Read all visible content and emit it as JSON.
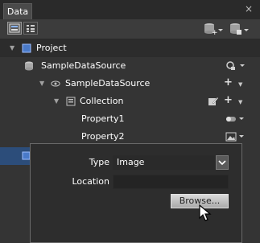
{
  "panel": {
    "title": "Data",
    "close_glyph": "×"
  },
  "toolbar": {
    "view_list_icon": "list-view-icon",
    "view_details_icon": "details-view-icon",
    "add_sample_data_icon": "add-sample-data-icon",
    "add_live_data_icon": "add-live-data-icon"
  },
  "tree": {
    "project_label": "Project",
    "datasource_label": "SampleDataSource",
    "datasource_child_label": "SampleDataSource",
    "collection_label": "Collection",
    "property1_label": "Property1",
    "property2_label": "Property2",
    "plus": "+",
    "caret": "▼",
    "expand": "▼"
  },
  "popup": {
    "type_label": "Type",
    "type_value": "Image",
    "type_dropdown_glyph": "⌄",
    "location_label": "Location",
    "location_value": "",
    "browse_label": "Browse..."
  },
  "colors": {
    "panel_bg": "#333333",
    "header_bg": "#2c2c2c",
    "popup_bg": "#2d2d2d",
    "button_light": "#d9d9d9",
    "accent_blue": "#4a7ac8"
  }
}
